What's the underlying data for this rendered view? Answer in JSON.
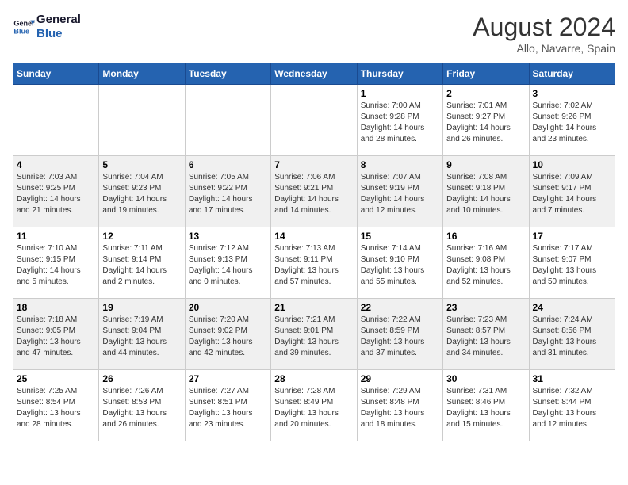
{
  "header": {
    "logo_line1": "General",
    "logo_line2": "Blue",
    "month_year": "August 2024",
    "location": "Allo, Navarre, Spain"
  },
  "weekdays": [
    "Sunday",
    "Monday",
    "Tuesday",
    "Wednesday",
    "Thursday",
    "Friday",
    "Saturday"
  ],
  "weeks": [
    [
      {
        "day": "",
        "info": ""
      },
      {
        "day": "",
        "info": ""
      },
      {
        "day": "",
        "info": ""
      },
      {
        "day": "",
        "info": ""
      },
      {
        "day": "1",
        "info": "Sunrise: 7:00 AM\nSunset: 9:28 PM\nDaylight: 14 hours\nand 28 minutes."
      },
      {
        "day": "2",
        "info": "Sunrise: 7:01 AM\nSunset: 9:27 PM\nDaylight: 14 hours\nand 26 minutes."
      },
      {
        "day": "3",
        "info": "Sunrise: 7:02 AM\nSunset: 9:26 PM\nDaylight: 14 hours\nand 23 minutes."
      }
    ],
    [
      {
        "day": "4",
        "info": "Sunrise: 7:03 AM\nSunset: 9:25 PM\nDaylight: 14 hours\nand 21 minutes."
      },
      {
        "day": "5",
        "info": "Sunrise: 7:04 AM\nSunset: 9:23 PM\nDaylight: 14 hours\nand 19 minutes."
      },
      {
        "day": "6",
        "info": "Sunrise: 7:05 AM\nSunset: 9:22 PM\nDaylight: 14 hours\nand 17 minutes."
      },
      {
        "day": "7",
        "info": "Sunrise: 7:06 AM\nSunset: 9:21 PM\nDaylight: 14 hours\nand 14 minutes."
      },
      {
        "day": "8",
        "info": "Sunrise: 7:07 AM\nSunset: 9:19 PM\nDaylight: 14 hours\nand 12 minutes."
      },
      {
        "day": "9",
        "info": "Sunrise: 7:08 AM\nSunset: 9:18 PM\nDaylight: 14 hours\nand 10 minutes."
      },
      {
        "day": "10",
        "info": "Sunrise: 7:09 AM\nSunset: 9:17 PM\nDaylight: 14 hours\nand 7 minutes."
      }
    ],
    [
      {
        "day": "11",
        "info": "Sunrise: 7:10 AM\nSunset: 9:15 PM\nDaylight: 14 hours\nand 5 minutes."
      },
      {
        "day": "12",
        "info": "Sunrise: 7:11 AM\nSunset: 9:14 PM\nDaylight: 14 hours\nand 2 minutes."
      },
      {
        "day": "13",
        "info": "Sunrise: 7:12 AM\nSunset: 9:13 PM\nDaylight: 14 hours\nand 0 minutes."
      },
      {
        "day": "14",
        "info": "Sunrise: 7:13 AM\nSunset: 9:11 PM\nDaylight: 13 hours\nand 57 minutes."
      },
      {
        "day": "15",
        "info": "Sunrise: 7:14 AM\nSunset: 9:10 PM\nDaylight: 13 hours\nand 55 minutes."
      },
      {
        "day": "16",
        "info": "Sunrise: 7:16 AM\nSunset: 9:08 PM\nDaylight: 13 hours\nand 52 minutes."
      },
      {
        "day": "17",
        "info": "Sunrise: 7:17 AM\nSunset: 9:07 PM\nDaylight: 13 hours\nand 50 minutes."
      }
    ],
    [
      {
        "day": "18",
        "info": "Sunrise: 7:18 AM\nSunset: 9:05 PM\nDaylight: 13 hours\nand 47 minutes."
      },
      {
        "day": "19",
        "info": "Sunrise: 7:19 AM\nSunset: 9:04 PM\nDaylight: 13 hours\nand 44 minutes."
      },
      {
        "day": "20",
        "info": "Sunrise: 7:20 AM\nSunset: 9:02 PM\nDaylight: 13 hours\nand 42 minutes."
      },
      {
        "day": "21",
        "info": "Sunrise: 7:21 AM\nSunset: 9:01 PM\nDaylight: 13 hours\nand 39 minutes."
      },
      {
        "day": "22",
        "info": "Sunrise: 7:22 AM\nSunset: 8:59 PM\nDaylight: 13 hours\nand 37 minutes."
      },
      {
        "day": "23",
        "info": "Sunrise: 7:23 AM\nSunset: 8:57 PM\nDaylight: 13 hours\nand 34 minutes."
      },
      {
        "day": "24",
        "info": "Sunrise: 7:24 AM\nSunset: 8:56 PM\nDaylight: 13 hours\nand 31 minutes."
      }
    ],
    [
      {
        "day": "25",
        "info": "Sunrise: 7:25 AM\nSunset: 8:54 PM\nDaylight: 13 hours\nand 28 minutes."
      },
      {
        "day": "26",
        "info": "Sunrise: 7:26 AM\nSunset: 8:53 PM\nDaylight: 13 hours\nand 26 minutes."
      },
      {
        "day": "27",
        "info": "Sunrise: 7:27 AM\nSunset: 8:51 PM\nDaylight: 13 hours\nand 23 minutes."
      },
      {
        "day": "28",
        "info": "Sunrise: 7:28 AM\nSunset: 8:49 PM\nDaylight: 13 hours\nand 20 minutes."
      },
      {
        "day": "29",
        "info": "Sunrise: 7:29 AM\nSunset: 8:48 PM\nDaylight: 13 hours\nand 18 minutes."
      },
      {
        "day": "30",
        "info": "Sunrise: 7:31 AM\nSunset: 8:46 PM\nDaylight: 13 hours\nand 15 minutes."
      },
      {
        "day": "31",
        "info": "Sunrise: 7:32 AM\nSunset: 8:44 PM\nDaylight: 13 hours\nand 12 minutes."
      }
    ]
  ]
}
